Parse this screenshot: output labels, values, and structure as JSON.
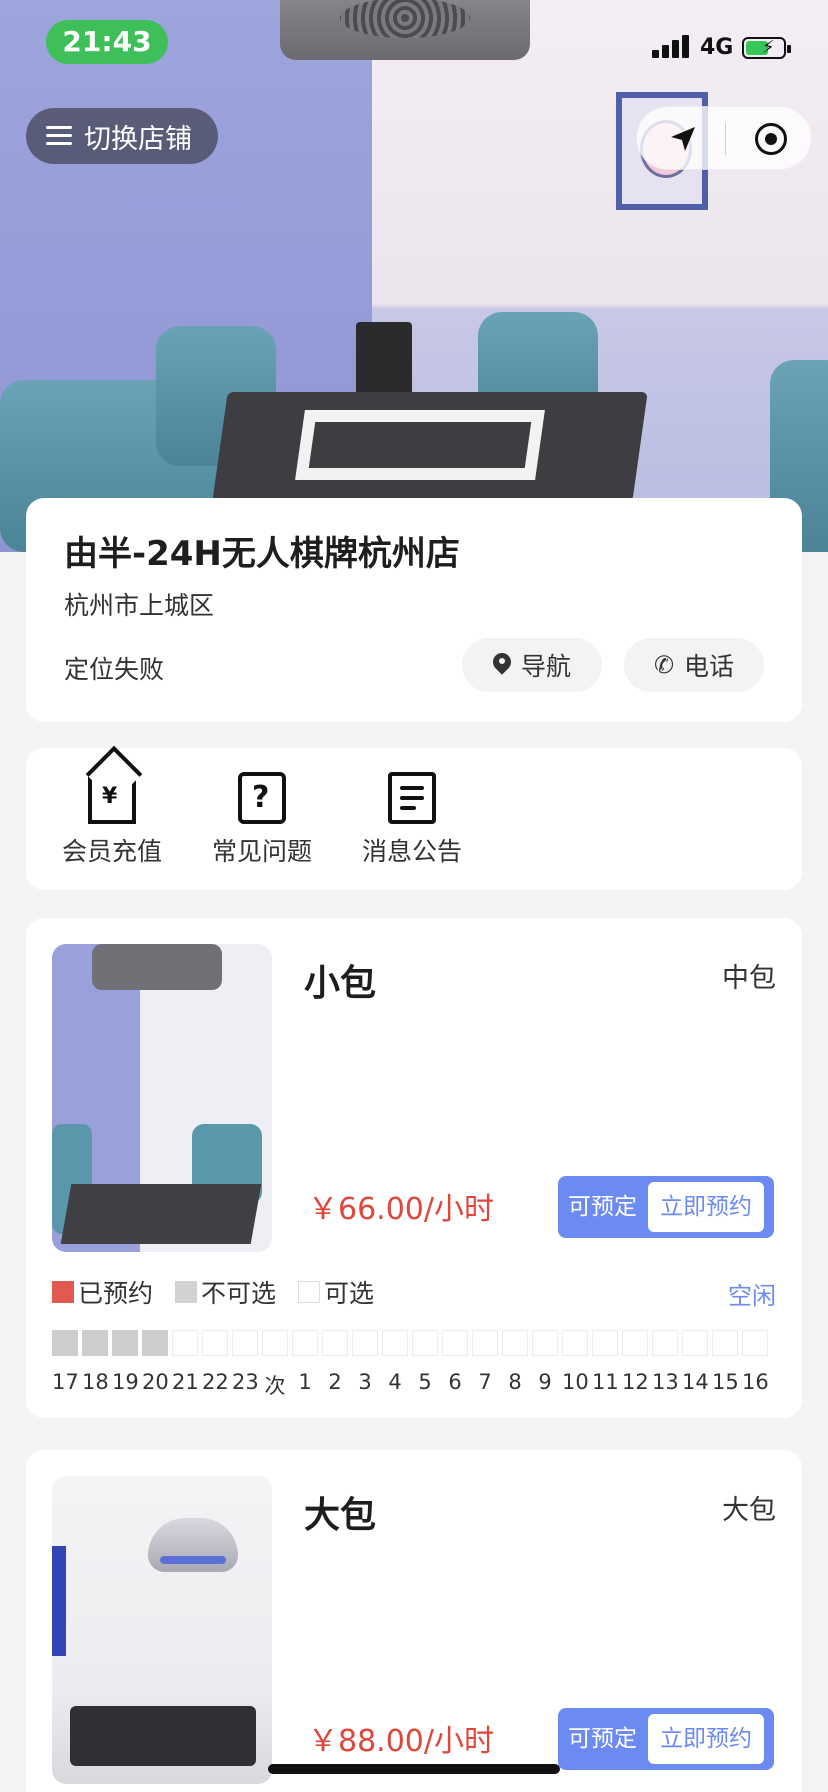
{
  "status_bar": {
    "time": "21:43",
    "network": "4G",
    "battery_color": "#35c759"
  },
  "header": {
    "switch_store_label": "切换店铺"
  },
  "store": {
    "name": "由半-24H无人棋牌杭州店",
    "address": "杭州市上城区",
    "location_status": "定位失败",
    "navigate_label": "导航",
    "phone_label": "电话"
  },
  "menu": {
    "items": [
      {
        "label": "会员充值",
        "icon": "member-recharge-icon"
      },
      {
        "label": "常见问题",
        "icon": "faq-icon"
      },
      {
        "label": "消息公告",
        "icon": "announcement-icon"
      }
    ]
  },
  "rooms": [
    {
      "name": "小包",
      "type": "中包",
      "price": "￥66.00/小时",
      "bookable_label": "可预定",
      "book_now_label": "立即预约",
      "legend": {
        "booked": "已预约",
        "unavailable": "不可选",
        "available": "可选"
      },
      "status": "空闲",
      "hours": [
        "17",
        "18",
        "19",
        "20",
        "21",
        "22",
        "23",
        "次",
        "1",
        "2",
        "3",
        "4",
        "5",
        "6",
        "7",
        "8",
        "9",
        "10",
        "11",
        "12",
        "13",
        "14",
        "15",
        "16"
      ],
      "unavailable_hours": [
        "17",
        "18",
        "19",
        "20"
      ]
    },
    {
      "name": "大包",
      "type": "大包",
      "price": "￥88.00/小时",
      "bookable_label": "可预定",
      "book_now_label": "立即预约"
    }
  ],
  "colors": {
    "accent": "#6b8af2",
    "price": "#e0463a",
    "booked": "#e05a4f",
    "unavailable": "#cdcdcd"
  }
}
